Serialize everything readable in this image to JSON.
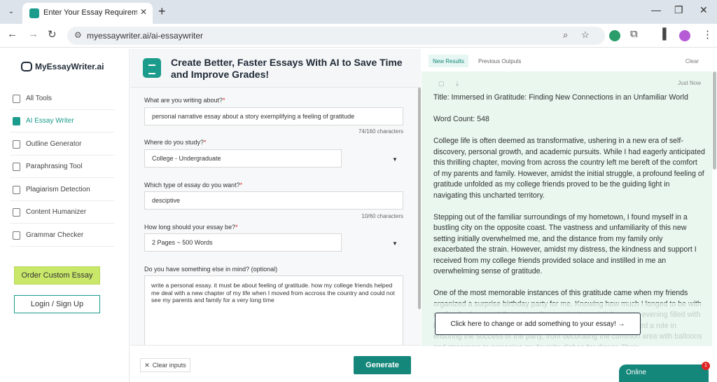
{
  "browser": {
    "tab_title": "Enter Your Essay Requirements",
    "url": "myessaywriter.ai/ai-essaywriter"
  },
  "sidebar": {
    "logo": "MyEssayWriter.ai",
    "items": [
      {
        "label": "All Tools"
      },
      {
        "label": "AI Essay Writer"
      },
      {
        "label": "Outline Generator"
      },
      {
        "label": "Paraphrasing Tool"
      },
      {
        "label": "Plagiarism Detection"
      },
      {
        "label": "Content Humanizer"
      },
      {
        "label": "Grammar Checker"
      }
    ],
    "order_label": "Order Custom Essay",
    "login_label": "Login / Sign Up"
  },
  "form": {
    "title": "Create Better, Faster Essays With AI to Save Time and Improve Grades!",
    "q1_label": "What are you writing about?",
    "q1_value": "personal narrative essay about a story exemplifying a feeling of gratitude",
    "q1_counter": "74/160 characters",
    "q2_label": "Where do you study?",
    "q2_value": "College - Undergraduate",
    "q3_label": "Which type of essay do you want?",
    "q3_value": "desciptive",
    "q3_counter": "10/60 characters",
    "q4_label": "How long should your essay be?",
    "q4_value": "2 Pages ~ 500 Words",
    "q5_label": "Do you have something else in mind? (optional)",
    "q5_value": "write a personal essay. it must be about feeling of gratitude. how my college friends helped me deal with a new chapter of my life when I moved from accross the country and could not see my parents and family for a very long time",
    "required_mark": "*",
    "clear_label": "Clear inputs",
    "generate_label": "Generate"
  },
  "output": {
    "tab_new": "New Results",
    "tab_prev": "Previous Outputs",
    "clear_label": "Clear",
    "timestamp": "Just Now",
    "title_line": "Title: Immersed in Gratitude: Finding New Connections in an Unfamiliar World",
    "word_count": "Word Count: 548",
    "para1": "College life is often deemed as transformative, ushering in a new era of self-discovery, personal growth, and academic pursuits. While I had eagerly anticipated this thrilling chapter, moving from across the country left me bereft of the comfort of my parents and family. However, amidst the initial struggle, a profound feeling of gratitude unfolded as my college friends proved to be the guiding light in navigating this uncharted territory.",
    "para2": "Stepping out of the familiar surroundings of my hometown, I found myself in a bustling city on the opposite coast. The vastness and unfamiliarity of this new setting initially overwhelmed me, and the distance from my family only exacerbated the strain. However, amidst my distress, the kindness and support I received from my college friends provided solace and instilled in me an overwhelming sense of gratitude.",
    "para3": "One of the most memorable instances of this gratitude came when my friends organized a surprise birthday party for me. Knowing how much I longed to be with my family, they went the extra mile to make it special. It was an evening filled with laughter, love, and warmth. Every single one of my friends played a role in ensuring the success of the party, from decorating the common area with balloons and streamers to arranging my favorite dishes for dinner. Their",
    "change_label": "Click here to change or add something to your essay! →",
    "online_label": "Online",
    "badge_count": "1"
  }
}
